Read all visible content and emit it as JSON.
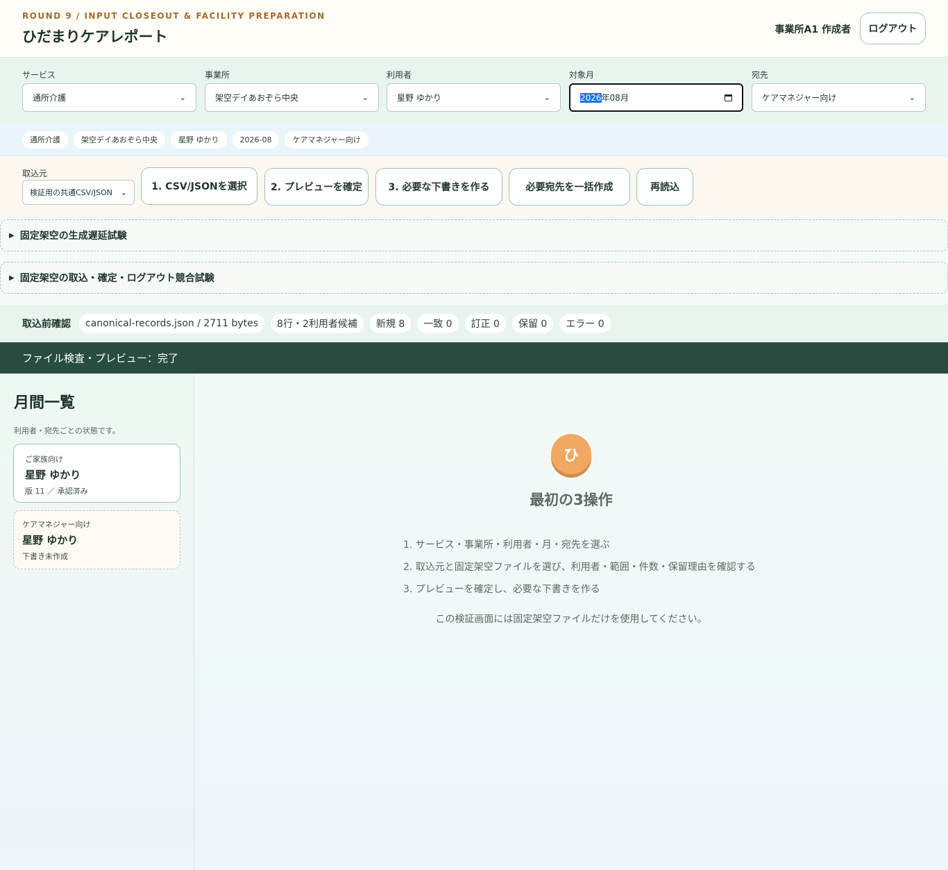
{
  "header": {
    "round": "ROUND 9 / INPUT CLOSEOUT & FACILITY PREPARATION",
    "title": "ひだまりケアレポート",
    "user": "事業所A1 作成者",
    "logout_label": "ログアウト"
  },
  "filters": [
    {
      "label": "サービス",
      "value": "通所介護"
    },
    {
      "label": "事業所",
      "value": "架空デイあおぞら中央"
    },
    {
      "label": "利用者",
      "value": "星野 ゆかり"
    },
    {
      "label": "対象月",
      "value_year": "2026",
      "value_rest": "年08月"
    },
    {
      "label": "宛先",
      "value": "ケアマネジャー向け"
    }
  ],
  "chips": [
    "通所介護",
    "架空デイあおぞら中央",
    "星野 ゆかり",
    "2026-08",
    "ケアマネジャー向け"
  ],
  "import": {
    "source_label": "取込元",
    "source_value": "検証用の共通CSV/JSON",
    "buttons": [
      "1. CSV/JSONを選択",
      "2. プレビューを確定",
      "3. 必要な下書きを作る",
      "必要宛先を一括作成",
      "再読込"
    ]
  },
  "details": [
    "固定架空の生成遅延試験",
    "固定架空の取込・確定・ログアウト競合試験"
  ],
  "precheck": {
    "label": "取込前確認",
    "chips": [
      "canonical-records.json / 2711 bytes",
      "8行・2利用者候補",
      "新規 8",
      "一致 0",
      "訂正 0",
      "保留 0",
      "エラー 0"
    ]
  },
  "status": "ファイル検査・プレビュー：完了",
  "sidebar": {
    "title": "月間一覧",
    "subtitle": "利用者・宛先ごとの状態です。",
    "cards": [
      {
        "type": "ご家族向け",
        "name": "星野 ゆかり",
        "status": "版 11 ／ 承認済み"
      },
      {
        "type": "ケアマネジャー向け",
        "name": "星野 ゆかり",
        "status": "下書き未作成"
      }
    ]
  },
  "main": {
    "avatar": "ひ",
    "title": "最初の3操作",
    "steps": [
      "1. サービス・事業所・利用者・月・宛先を選ぶ",
      "2. 取込元と固定架空ファイルを選び、利用者・範囲・件数・保留理由を確認する",
      "3. プレビューを確定し、必要な下書きを作る"
    ],
    "note": "この検証画面には固定架空ファイルだけを使用してください。"
  }
}
